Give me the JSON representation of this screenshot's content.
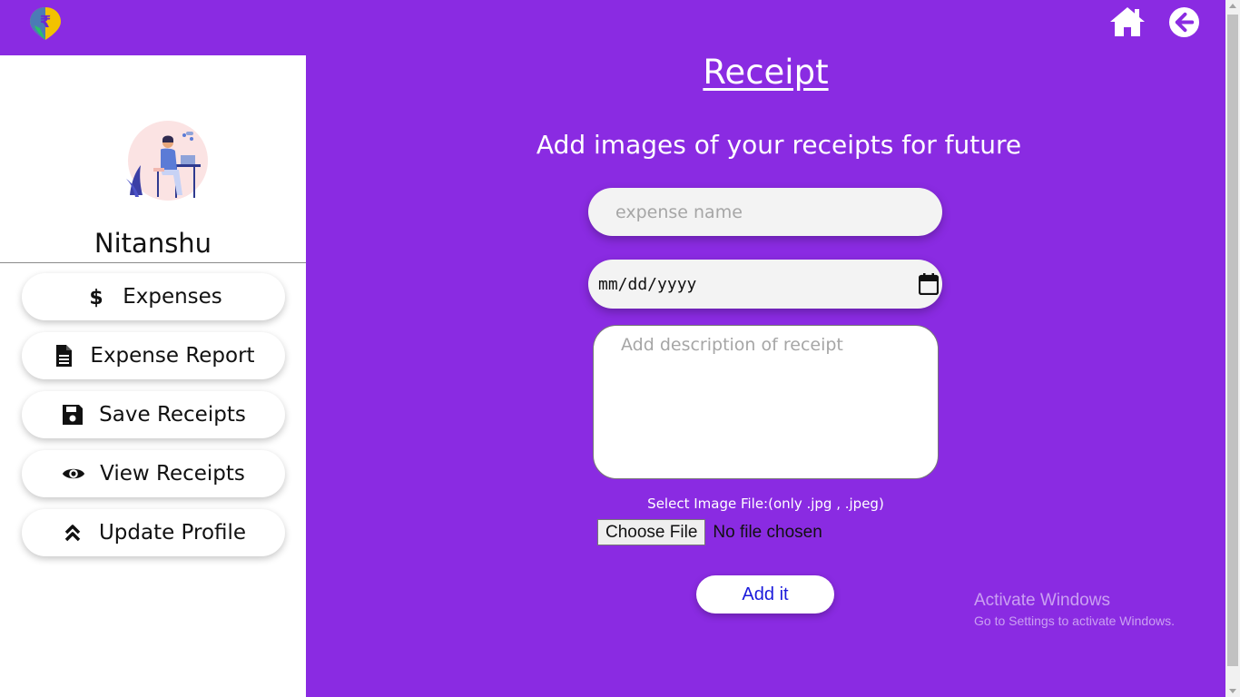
{
  "header": {
    "logo": "rupee-location-pin-icon",
    "home_icon": "home-icon",
    "back_icon": "arrow-left-circle-icon"
  },
  "sidebar": {
    "avatar": "person-at-laptop-illustration",
    "user_name": "Nitanshu",
    "items": [
      {
        "label": "Expenses",
        "icon": "dollar-icon"
      },
      {
        "label": "Expense Report",
        "icon": "document-icon"
      },
      {
        "label": "Save Receipts",
        "icon": "floppy-disk-icon"
      },
      {
        "label": "View Receipts",
        "icon": "eye-icon"
      },
      {
        "label": "Update Profile",
        "icon": "double-chevron-up-icon"
      }
    ]
  },
  "main": {
    "title": "Receipt",
    "subtitle": "Add images of your receipts for future",
    "expense_name_placeholder": "expense name",
    "date_placeholder": "mm/dd/yyyy",
    "description_placeholder": "Add description of receipt",
    "file_label": "Select Image File:(only .jpg , .jpeg)",
    "choose_file_label": "Choose File",
    "no_file_text": "No file chosen",
    "submit_label": "Add it"
  },
  "watermark": {
    "line1": "Activate Windows",
    "line2": "Go to Settings to activate Windows."
  },
  "colors": {
    "background": "#8a2be2",
    "sidebar": "#ffffff",
    "button_text": "#1a1adb"
  }
}
